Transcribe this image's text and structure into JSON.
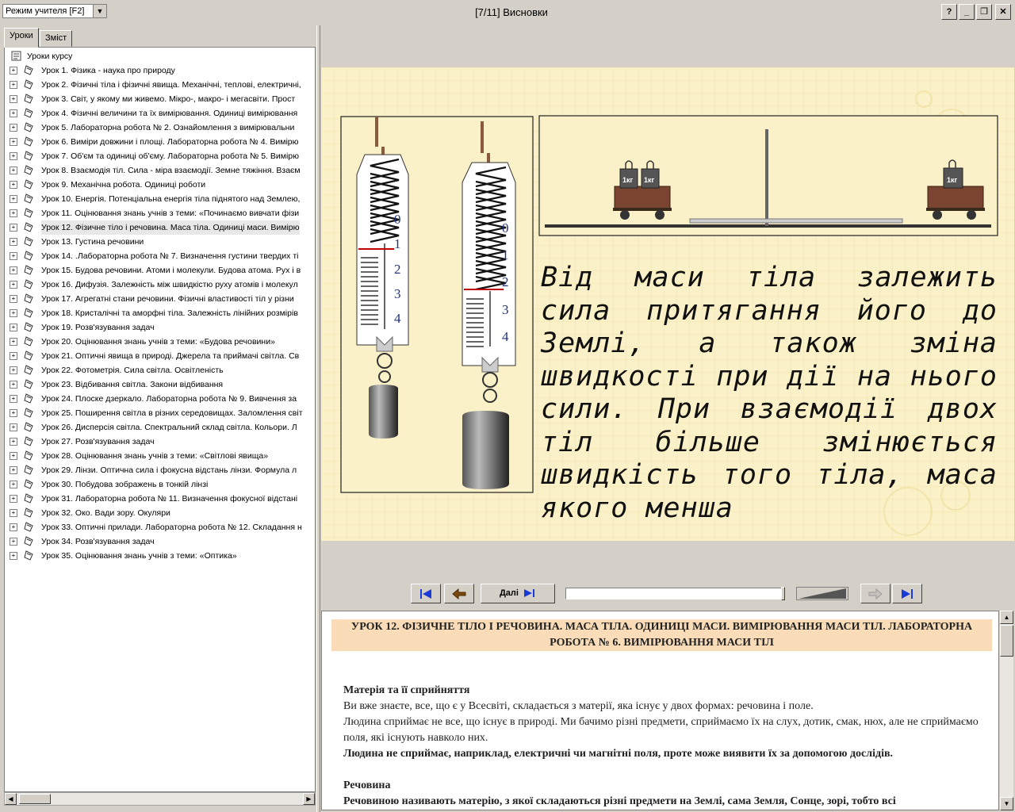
{
  "window": {
    "title": "[7/11] Висновки",
    "mode_select": "Режим учителя [F2]",
    "buttons": {
      "help": "?",
      "minimize": "_",
      "restore": "❐",
      "close": "✕"
    }
  },
  "tabs": [
    "Уроки",
    "Зміст"
  ],
  "tree": {
    "root": "Уроки курсу",
    "items": [
      "Урок 1. Фізика - наука про природу",
      "Урок 2. Фізичні тіла і фізичні явища. Механічні, теплові, електричні,",
      "Урок 3. Світ, у якому ми живемо. Мікро-, макро- і мегасвіти. Прост",
      "Урок 4. Фізичні величини та їх вимірювання. Одиниці вимірювання",
      "Урок 5. Лабораторна робота № 2. Ознайомлення з вимірювальни",
      "Урок 6. Виміри довжини і площі. Лабораторна робота № 4. Вимірю",
      "Урок 7. Об'єм та одиниці об'єму. Лабораторна робота № 5. Вимірю",
      "Урок 8. Взаємодія тіл. Сила - міра взаємодії. Земне тяжіння. Взаєм",
      "Урок 9. Механічна робота. Одиниці роботи",
      "Урок 10. Енергія. Потенціальна енергія тіла піднятого над Землею,",
      "Урок 11. Оцінювання знань учнів з теми: «Починаємо вивчати фізи",
      "Урок 12. Фізичне тіло і речовина. Маса тіла. Одиниці маси. Вимірю",
      "Урок 13. Густина речовини",
      "Урок 14. .Лабораторна робота № 7. Визначення густини твердих ті",
      "Урок 15. Будова речовини. Атоми і молекули. Будова атома. Рух і в",
      "Урок 16. Дифузія. Залежність між швидкістю руху атомів і молекул",
      "Урок 17. Агрегатні стани речовини. Фізичні властивості тіл у різни",
      "Урок 18. Кристалічні та аморфні тіла. Залежність лінійних розмірів",
      "Урок 19. Розв'язування задач",
      "Урок 20. Оцінювання знань учнів з теми: «Будова речовини»",
      "Урок 21. Оптичні явища в природі. Джерела та приймачі світла. Св",
      "Урок 22. Фотометрія. Сила світла. Освітленість",
      "Урок 23. Відбивання світла. Закони відбивання",
      "Урок 24. Плоске дзеркало. Лабораторна робота № 9. Вивчення за",
      "Урок 25. Поширення світла в різних середовищах. Заломлення світ",
      "Урок 26. Дисперсія світла. Спектральний склад світла. Кольори. Л",
      "Урок 27. Розв'язування задач",
      "Урок 28. Оцінювання знань учнів з теми: «Світлові явища»",
      "Урок 29. Лінзи. Оптична сила і фокусна відстань лінзи. Формула л",
      "Урок 30. Побудова зображень в тонкій лінзі",
      "Урок 31. Лабораторна робота № 11. Визначення фокусної відстані",
      "Урок 32. Око. Вади зору. Окуляри",
      "Урок 33. Оптичні прилади. Лабораторна робота № 12. Складання н",
      "Урок 34. Розв'язування задач",
      "Урок 35. Оцінювання знань учнів з теми: «Оптика»"
    ]
  },
  "slide": {
    "text": "Від маси тіла залежить сила притягання його до Землі, а також зміна швидкості при дії на нього сили. При взаємодії двох тіл більше змінюється швидкість того тіла, маса якого менша",
    "scale1_marks": [
      "0",
      "1",
      "2",
      "3",
      "4"
    ],
    "scale2_marks": [
      "0",
      "1",
      "2",
      "3",
      "4"
    ],
    "weight_label": "1кг"
  },
  "nav": {
    "next_label": "Далі"
  },
  "content": {
    "heading": "УРОК 12. ФІЗИЧНЕ ТІЛО І РЕЧОВИНА. МАСА ТІЛА. ОДИНИЦІ МАСИ. ВИМІРЮВАННЯ МАСИ ТІЛ. ЛАБОРАТОРНА РОБОТА № 6. ВИМІРЮВАННЯ МАСИ ТІЛ",
    "section1_title": "Матерія та її сприйняття",
    "p1": "Ви вже знаєте, все, що є у Всесвіті, складається з матерії, яка існує у двох формах: речовина і поле.",
    "p2": "Людина сприймає не все, що існує в природі. Ми бачимо різні предмети, сприймаємо їх на слух, дотик, смак, нюх, але не сприймаємо поля, які існують навколо них.",
    "p3": "Людина не сприймає, наприклад, електричні чи магнітні поля, проте може виявити їх за допомогою дослідів.",
    "section2_title": "Речовина",
    "p4": "Речовиною називають матерію, з якої складаються різні предмети на Землі, сама Земля, Сонце, зорі, тобто всі"
  },
  "colors": {
    "slide_bg": "#fbf1c8",
    "heading_bg": "#fadcb8",
    "red_mark": "#c00000"
  }
}
